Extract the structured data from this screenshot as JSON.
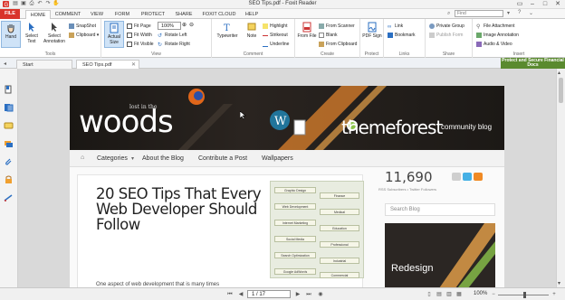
{
  "titlebar": {
    "title": "SEO Tips.pdf - Foxit Reader"
  },
  "ribbon_tabs": {
    "file": "FILE",
    "items": [
      {
        "label": "HOME"
      },
      {
        "label": "COMMENT"
      },
      {
        "label": "VIEW"
      },
      {
        "label": "FORM"
      },
      {
        "label": "PROTECT"
      },
      {
        "label": "SHARE"
      },
      {
        "label": "FOXIT CLOUD"
      },
      {
        "label": "HELP"
      }
    ],
    "find_placeholder": "Find"
  },
  "ribbon": {
    "tools": {
      "label": "Tools",
      "hand": "Hand",
      "select_text": "Select Text",
      "select_annotation": "Select Annotation",
      "snapshot": "SnapShot",
      "clipboard": "Clipboard"
    },
    "view": {
      "label": "View",
      "actual_size": "Actual Size",
      "fit_page": "Fit Page",
      "fit_width": "Fit Width",
      "fit_visible": "Fit Visible",
      "zoom_value": "100%",
      "rotate_left": "Rotate Left",
      "rotate_right": "Rotate Right"
    },
    "comment": {
      "label": "Comment",
      "typewriter": "Typewriter",
      "note": "Note",
      "highlight": "Highlight",
      "strikeout": "Strikeout",
      "underline": "Underline"
    },
    "create": {
      "label": "Create",
      "from_file": "From File",
      "from_scanner": "From Scanner",
      "blank": "Blank",
      "from_clipboard": "From Clipboard"
    },
    "protect": {
      "label": "Protect",
      "pdf_sign": "PDF Sign"
    },
    "links": {
      "label": "Links",
      "link": "Link",
      "bookmark": "Bookmark"
    },
    "share": {
      "label": "Share",
      "private_group": "Private Group",
      "publish_form": "Publish Form"
    },
    "insert": {
      "label": "Insert",
      "file_attachment": "File Attachment",
      "image_annotation": "Image Annotation",
      "audio_video": "Audio & Video"
    }
  },
  "doc_tabs": {
    "start": "Start",
    "seo": "SEO Tips.pdf",
    "promo": "Protect and Secure Financial Docs"
  },
  "doc": {
    "lost_in_the": "lost in the",
    "woods": "woods",
    "themeforest": "themeforest",
    "community_blog": "community blog",
    "nav": [
      {
        "label": "Categories"
      },
      {
        "label": "About the Blog"
      },
      {
        "label": "Contribute a Post"
      },
      {
        "label": "Wallpapers"
      }
    ],
    "headline": "20 SEO Tips That Every Web Developer Should Follow",
    "intro": "One aspect of web development that is many times",
    "subs_count": "11,690",
    "subs_line": "RSS Subscribers • Twitter Followers",
    "search_blog": "Search Blog",
    "redesign": "Redesign",
    "infographic_labels": [
      {
        "label": "Graphic Design"
      },
      {
        "label": "Finance"
      },
      {
        "label": "Web Development"
      },
      {
        "label": "Medical"
      },
      {
        "label": "Internet Marketing"
      },
      {
        "label": "Education"
      },
      {
        "label": "Social Media"
      },
      {
        "label": "Professional"
      },
      {
        "label": "Search Optimization"
      },
      {
        "label": "Industrial"
      },
      {
        "label": "Google AdWords"
      },
      {
        "label": "Commercial"
      }
    ]
  },
  "statusbar": {
    "page_value": "1 / 17",
    "zoom": "100%"
  },
  "colors": {
    "file_tab": "#d9342b",
    "promo_bg": "#5a8a2f",
    "selected_btn": "#cfe3f7"
  }
}
